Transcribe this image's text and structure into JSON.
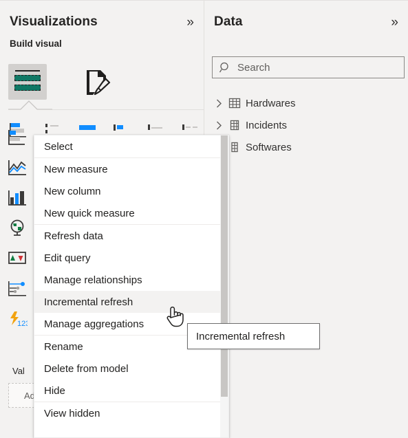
{
  "visualizations": {
    "title": "Visualizations",
    "collapse_icon": "chevron-double-right-icon",
    "collapse_glyph": "»",
    "build_visual_label": "Build visual",
    "tabs": [
      {
        "name": "build-visual-fields-tab",
        "icon": "fields-table-icon",
        "selected": true
      },
      {
        "name": "format-visual-tab",
        "icon": "paintbrush-page-icon",
        "selected": false
      }
    ],
    "gallery_icons": [
      "stacked-bar-chart-icon",
      "clustered-bar-chart-icon",
      "100-stacked-bar-chart-icon",
      "stacked-column-chart-icon",
      "clustered-column-chart-icon",
      "100-stacked-column-chart-icon",
      "line-chart-icon",
      "area-chart-icon",
      "stacked-area-chart-icon",
      "line-and-stacked-column-chart-icon",
      "ribbon-chart-icon",
      "waterfall-chart-icon",
      "funnel-chart-icon",
      "scatter-chart-icon",
      "pie-chart-icon",
      "map-icon",
      "filled-map-icon",
      "treemap-icon",
      "kpi-icon",
      "slicer-icon",
      "table-icon",
      "matrix-icon",
      "card-icon",
      "multi-row-card-icon",
      "gauge-icon",
      "decomposition-tree-icon",
      "key-influencers-icon",
      "python-visual-icon",
      "r-script-visual-icon"
    ],
    "wells": {
      "values_label": "Values",
      "values_label_clipped": "Val",
      "add_field_placeholder": "Add data fields here",
      "add_field_clipped": "Ad"
    }
  },
  "data": {
    "title": "Data",
    "collapse_icon": "chevron-double-right-icon",
    "collapse_glyph": "»",
    "search": {
      "placeholder": "Search",
      "value": "",
      "icon": "search-icon"
    },
    "tables": [
      {
        "label": "Hardwares",
        "icon": "table-grid-icon",
        "expanded": false,
        "chevron": "chevron-right-icon"
      },
      {
        "label": "Incidents",
        "icon": "table-grid-icon",
        "expanded": false,
        "chevron": "chevron-right-icon"
      },
      {
        "label": "Softwares",
        "icon": "table-grid-icon",
        "expanded": false,
        "chevron": "chevron-right-icon"
      }
    ]
  },
  "context_menu": {
    "items": [
      {
        "label": "Select",
        "highlighted": false,
        "separator_after": true
      },
      {
        "label": "New measure",
        "highlighted": false,
        "separator_after": false
      },
      {
        "label": "New column",
        "highlighted": false,
        "separator_after": false
      },
      {
        "label": "New quick measure",
        "highlighted": false,
        "separator_after": true
      },
      {
        "label": "Refresh data",
        "highlighted": false,
        "separator_after": false
      },
      {
        "label": "Edit query",
        "highlighted": false,
        "separator_after": false
      },
      {
        "label": "Manage relationships",
        "highlighted": false,
        "separator_after": false
      },
      {
        "label": "Incremental refresh",
        "highlighted": true,
        "separator_after": false
      },
      {
        "label": "Manage aggregations",
        "highlighted": false,
        "separator_after": true
      },
      {
        "label": "Rename",
        "highlighted": false,
        "separator_after": false
      },
      {
        "label": "Delete from model",
        "highlighted": false,
        "separator_after": false
      },
      {
        "label": "Hide",
        "highlighted": false,
        "separator_after": true
      },
      {
        "label": "View hidden",
        "highlighted": false,
        "separator_after": false
      }
    ]
  },
  "tooltip": {
    "text": "Incremental refresh"
  },
  "cursor": {
    "icon": "hand-pointer-cursor"
  },
  "colors": {
    "panel_background": "#f3f2f1",
    "menu_background": "#ffffff",
    "menu_highlight": "#f3f2f1",
    "accent_teal": "#117865",
    "accent_blue": "#118dff",
    "text_primary": "#201f1e",
    "text_secondary": "#605e5c",
    "border": "#e1dfdd"
  }
}
